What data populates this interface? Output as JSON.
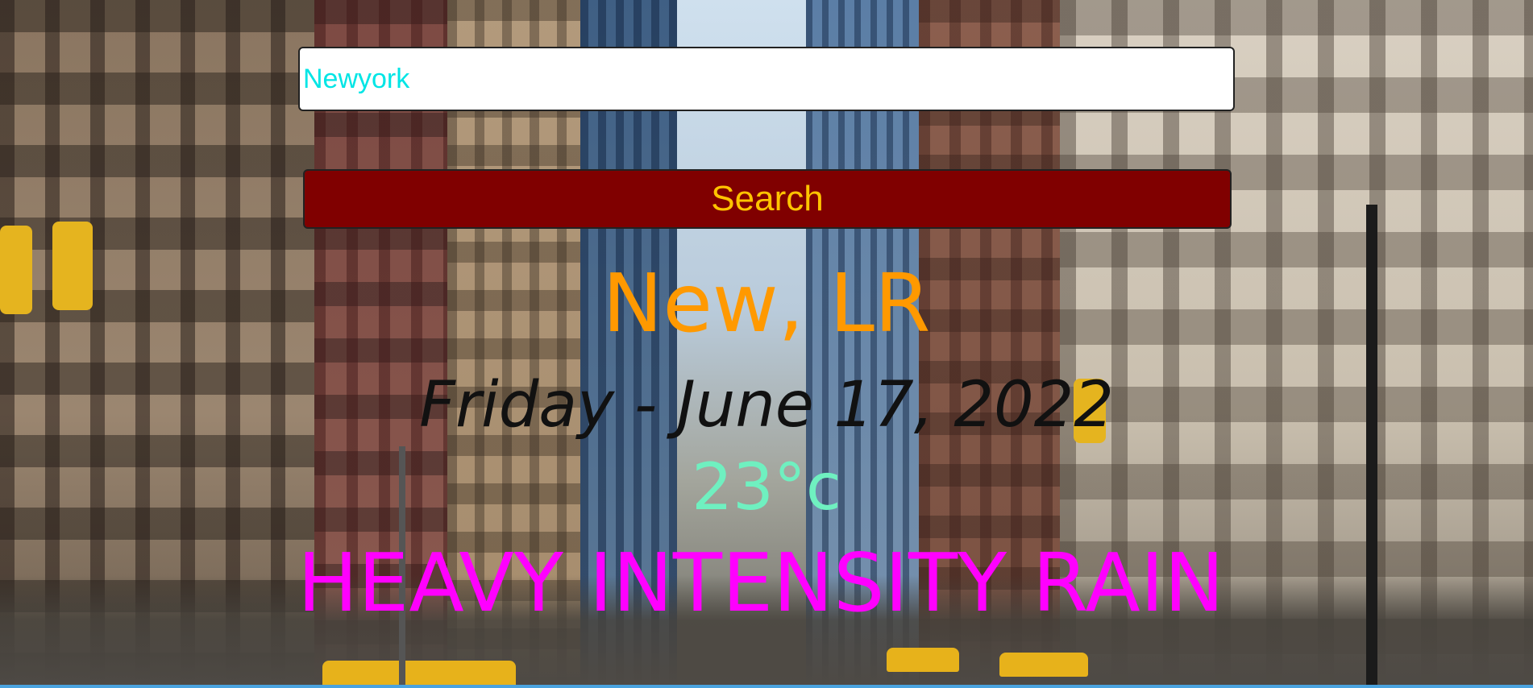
{
  "search": {
    "value": "Newyork",
    "button_label": "Search"
  },
  "weather": {
    "city": "New, LR",
    "date": "Friday - June 17, 2022",
    "temperature": "23°c",
    "description": "HEAVY INTENSITY RAIN"
  },
  "colors": {
    "input_text": "#00e5e5",
    "button_bg": "#800000",
    "button_text": "#ffc400",
    "city": "#ff9900",
    "date": "#111111",
    "temperature": "#6ff0c0",
    "description": "#ff00ff"
  },
  "background": {
    "icon": "new-york-street-photo"
  }
}
